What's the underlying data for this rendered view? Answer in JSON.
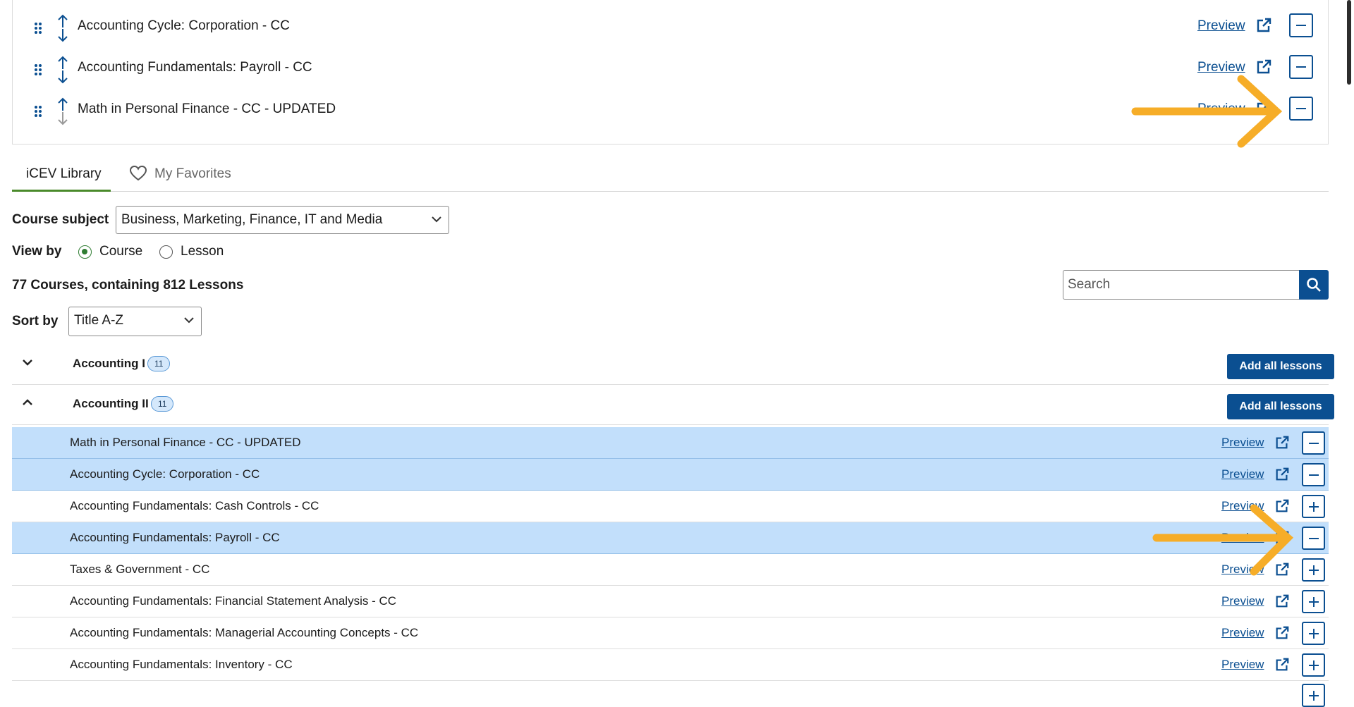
{
  "selected_lessons": [
    {
      "title": "Accounting Cycle: Corporation - CC",
      "preview": "Preview"
    },
    {
      "title": "Accounting Fundamentals: Payroll - CC",
      "preview": "Preview"
    },
    {
      "title": "Math in Personal Finance - CC - UPDATED",
      "preview": "Preview"
    }
  ],
  "tabs": {
    "library": "iCEV Library",
    "favorites": "My Favorites"
  },
  "filters": {
    "course_subject_label": "Course subject",
    "course_subject_value": "Business, Marketing, Finance, IT and Media",
    "view_by_label": "View by",
    "view_options": [
      "Course",
      "Lesson"
    ],
    "view_selected": "Course",
    "sort_label": "Sort by",
    "sort_value": "Title A-Z"
  },
  "summary": "77 Courses, containing 812 Lessons",
  "search": {
    "placeholder": "Search"
  },
  "courses": [
    {
      "name": "Accounting I",
      "count": "11",
      "expanded": false,
      "add_all": "Add all lessons"
    },
    {
      "name": "Accounting II",
      "count": "11",
      "expanded": true,
      "add_all": "Add all lessons"
    }
  ],
  "lessons": [
    {
      "title": "Math in Personal Finance - CC - UPDATED",
      "preview": "Preview",
      "added": true
    },
    {
      "title": "Accounting Cycle: Corporation - CC",
      "preview": "Preview",
      "added": true
    },
    {
      "title": "Accounting Fundamentals: Cash Controls - CC",
      "preview": "Preview",
      "added": false
    },
    {
      "title": "Accounting Fundamentals: Payroll - CC",
      "preview": "Preview",
      "added": true
    },
    {
      "title": "Taxes & Government - CC",
      "preview": "Preview",
      "added": false
    },
    {
      "title": "Accounting Fundamentals: Financial Statement Analysis - CC",
      "preview": "Preview",
      "added": false
    },
    {
      "title": "Accounting Fundamentals: Managerial Accounting Concepts - CC",
      "preview": "Preview",
      "added": false
    },
    {
      "title": "Accounting Fundamentals: Inventory - CC",
      "preview": "Preview",
      "added": false
    }
  ],
  "colors": {
    "brand": "#0b4f91",
    "selected_row": "#c2dffb",
    "tab_active": "#4a8a2b",
    "annotation_arrow": "#f6ad28"
  }
}
